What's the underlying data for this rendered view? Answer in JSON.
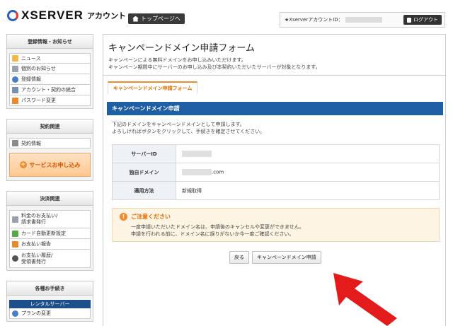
{
  "header": {
    "logo_text": "XSERVER",
    "logo_sub": "アカウント",
    "top_button": "トップページへ",
    "account_label": "★XserverアカウントID：",
    "logout": "ログアウト"
  },
  "sidebar": {
    "sections": [
      {
        "title": "登録情報・お知らせ",
        "items": [
          "ニュース",
          "個別のお知らせ",
          "登録情報",
          "アカウント・契約の統合",
          "パスワード変更"
        ]
      },
      {
        "title": "契約関連",
        "items": [
          "契約情報"
        ],
        "service_button": "サービスお申し込み"
      },
      {
        "title": "決済関連",
        "items": [
          "料金のお支払い/\n請求書発行",
          "カード自動更新設定",
          "お支払い報告",
          "お支払い履歴/\n受領書発行"
        ]
      },
      {
        "title": "各種お手続き",
        "subhead": "レンタルサーバー",
        "items": [
          "プランの変更"
        ]
      }
    ]
  },
  "main": {
    "title": "キャンペーンドメイン申請フォーム",
    "intro_1": "キャンペーンによる無料ドメインをお申し込みいただけます。",
    "intro_2": "キャンペーン期間中にサーバーのお申し込み及び本契約いただいたサーバーが対象となります。",
    "tab": "キャンペーンドメイン申請フォーム",
    "section_title": "キャンペーンドメイン申請",
    "desc_1": "下記のドメインをキャンペーンドメインとして申請します。",
    "desc_2": "よろしければボタンをクリックして、手続きを確定させてください。",
    "rows": [
      {
        "label": "サーバーID",
        "value": ""
      },
      {
        "label": "独自ドメイン",
        "value": ".com"
      },
      {
        "label": "適用方法",
        "value": "新規取得"
      }
    ],
    "caution_title": "ご注意ください",
    "caution_1": "一度申請いただいたドメイン名は、申請後のキャンセルや変更ができません。",
    "caution_2": "申請を行われる前に、ドメイン名に誤りがないか今一度ご確認ください。",
    "back_button": "戻る",
    "submit_button": "キャンペーンドメイン申請"
  },
  "colors": {
    "accent": "#1f5fa5",
    "orange": "#f08b2c",
    "arrow": "#e31b1b"
  }
}
